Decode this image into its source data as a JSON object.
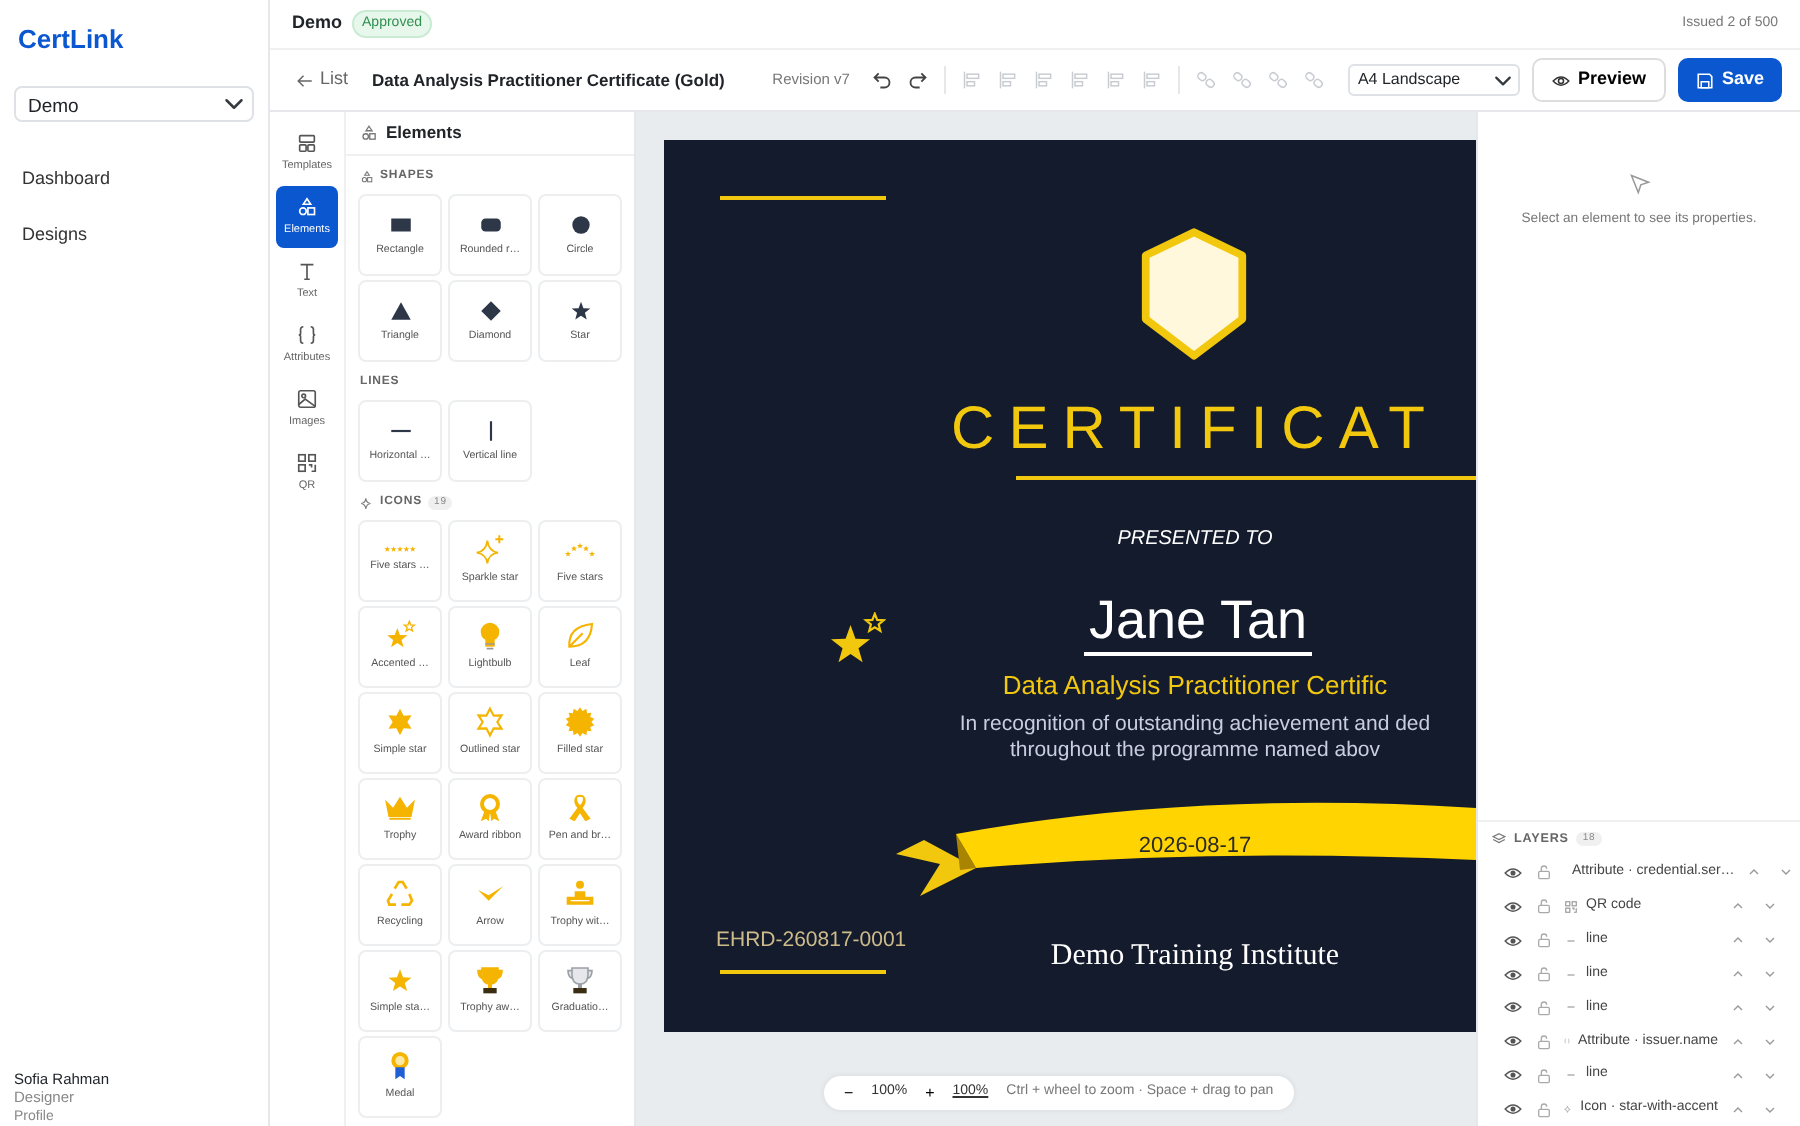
{
  "sidebar": {
    "brand": "CertLink",
    "workspace": "Demo",
    "nav": [
      "Dashboard",
      "Designs"
    ],
    "user": {
      "name": "Sofia Rahman",
      "role": "Designer",
      "link": "Profile"
    }
  },
  "header": {
    "project": "Demo",
    "status": "Approved",
    "issued": "Issued 2 of 500"
  },
  "toolbar": {
    "back": "List",
    "title": "Data Analysis Practitioner Certificate (Gold)",
    "revision": "Revision v7",
    "tools": [
      {
        "kind": "undo",
        "disabled": false
      },
      {
        "kind": "redo",
        "disabled": false
      },
      {
        "kind": "align",
        "disabled": true
      },
      {
        "kind": "align",
        "disabled": true
      },
      {
        "kind": "align",
        "disabled": true
      },
      {
        "kind": "align",
        "disabled": true
      },
      {
        "kind": "align",
        "disabled": true
      },
      {
        "kind": "align",
        "disabled": true
      },
      {
        "kind": "link",
        "disabled": true
      },
      {
        "kind": "link",
        "disabled": true
      },
      {
        "kind": "link",
        "disabled": true
      },
      {
        "kind": "link",
        "disabled": true
      }
    ],
    "page_size": "A4 Landscape",
    "preview": "Preview",
    "save": "Save"
  },
  "rail": [
    {
      "label": "Templates",
      "selected": false
    },
    {
      "label": "Elements",
      "selected": true
    },
    {
      "label": "Text",
      "selected": false
    },
    {
      "label": "Attributes",
      "selected": false
    },
    {
      "label": "Images",
      "selected": false
    },
    {
      "label": "QR",
      "selected": false
    }
  ],
  "elements_panel": {
    "title": "Elements",
    "sections": [
      {
        "title": "SHAPES",
        "tiles": [
          "Rectangle",
          "Rounded r…",
          "Circle",
          "Triangle",
          "Diamond",
          "Star"
        ]
      },
      {
        "title": "LINES",
        "tiles": [
          "Horizontal …",
          "Vertical line"
        ]
      },
      {
        "title": "ICONS",
        "count": "19",
        "tiles": [
          "Five stars …",
          "Sparkle star",
          "Five stars",
          "Accented …",
          "Lightbulb",
          "Leaf",
          "Simple star",
          "Outlined star",
          "Filled star",
          "Trophy",
          "Award ribbon",
          "Pen and br…",
          "Recycling",
          "Arrow",
          "Trophy wit…",
          "Simple sta…",
          "Trophy aw…",
          "Graduatio…",
          "Medal"
        ]
      }
    ]
  },
  "certificate": {
    "heading": "CERTIFICAT",
    "presented": "PRESENTED TO",
    "recipient": "Jane Tan",
    "course": "Data Analysis Practitioner Certific",
    "description": [
      "In recognition of outstanding achievement and ded",
      "throughout the programme named abov"
    ],
    "date": "2026-08-17",
    "serial": "EHRD-260817-0001",
    "issuer": "Demo Training Institute"
  },
  "zoom_bar": {
    "minus": "−",
    "level": "100%",
    "plus": "+",
    "reset": "100%",
    "hint": "Ctrl + wheel to zoom · Space + drag to pan"
  },
  "properties": {
    "empty_text": "Select an element to see its properties."
  },
  "layers": {
    "title": "LAYERS",
    "count": "18",
    "items": [
      {
        "kind": "attribute",
        "label": "Attribute · credential.ser…"
      },
      {
        "kind": "qr",
        "label": "QR code"
      },
      {
        "kind": "line",
        "label": "line"
      },
      {
        "kind": "line",
        "label": "line"
      },
      {
        "kind": "line",
        "label": "line"
      },
      {
        "kind": "attribute",
        "label": "Attribute · issuer.name"
      },
      {
        "kind": "line",
        "label": "line"
      },
      {
        "kind": "icon",
        "label": "Icon · star-with-accent"
      }
    ]
  }
}
